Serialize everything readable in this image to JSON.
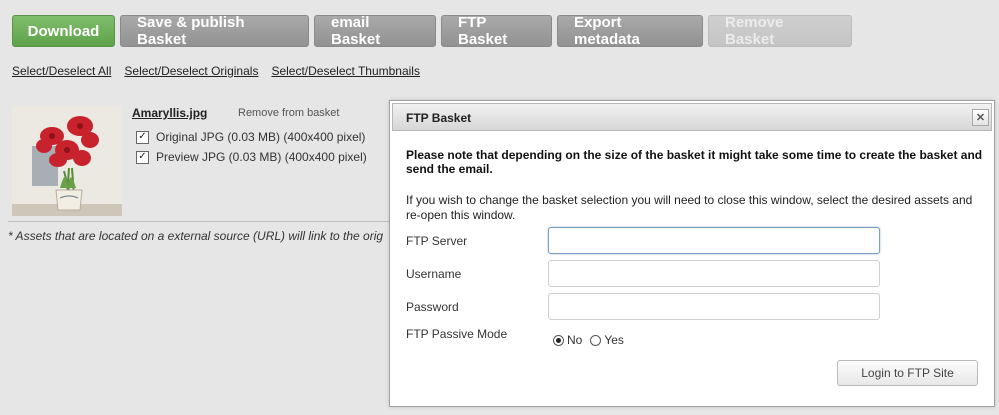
{
  "toolbar": {
    "download": "Download",
    "save_publish": "Save & publish Basket",
    "email": "email Basket",
    "ftp": "FTP Basket",
    "export": "Export metadata",
    "remove": "Remove Basket"
  },
  "select_links": {
    "all": "Select/Deselect All",
    "originals": "Select/Deselect Originals",
    "thumbnails": "Select/Deselect Thumbnails"
  },
  "asset": {
    "name": "Amaryllis.jpg",
    "remove": "Remove from basket",
    "options": [
      {
        "label": "Original JPG (0.03 MB) (400x400 pixel)",
        "checked": true
      },
      {
        "label": "Preview JPG (0.03 MB) (400x400 pixel)",
        "checked": true
      }
    ]
  },
  "footnote": "* Assets that are located on a external source (URL) will link to the orig",
  "dialog": {
    "title": "FTP Basket",
    "close_icon": "close-icon",
    "notice": "Please note that depending on the size of the basket it might take some time to create the basket and send the email.",
    "info": "If you wish to change the basket selection you will need to close this window, select the desired assets and re-open this window.",
    "fields": {
      "server_label": "FTP Server",
      "server_value": "",
      "username_label": "Username",
      "username_value": "",
      "password_label": "Password",
      "password_value": ""
    },
    "passive_mode": {
      "label": "FTP Passive Mode",
      "options": [
        "No",
        "Yes"
      ],
      "selected": "No"
    },
    "login_button": "Login to FTP Site"
  },
  "colors": {
    "download_green": "#6bae55",
    "toolbar_gray": "#9d9d9d",
    "disabled_gray": "#c9c9c9",
    "background": "#e6e6e6"
  }
}
